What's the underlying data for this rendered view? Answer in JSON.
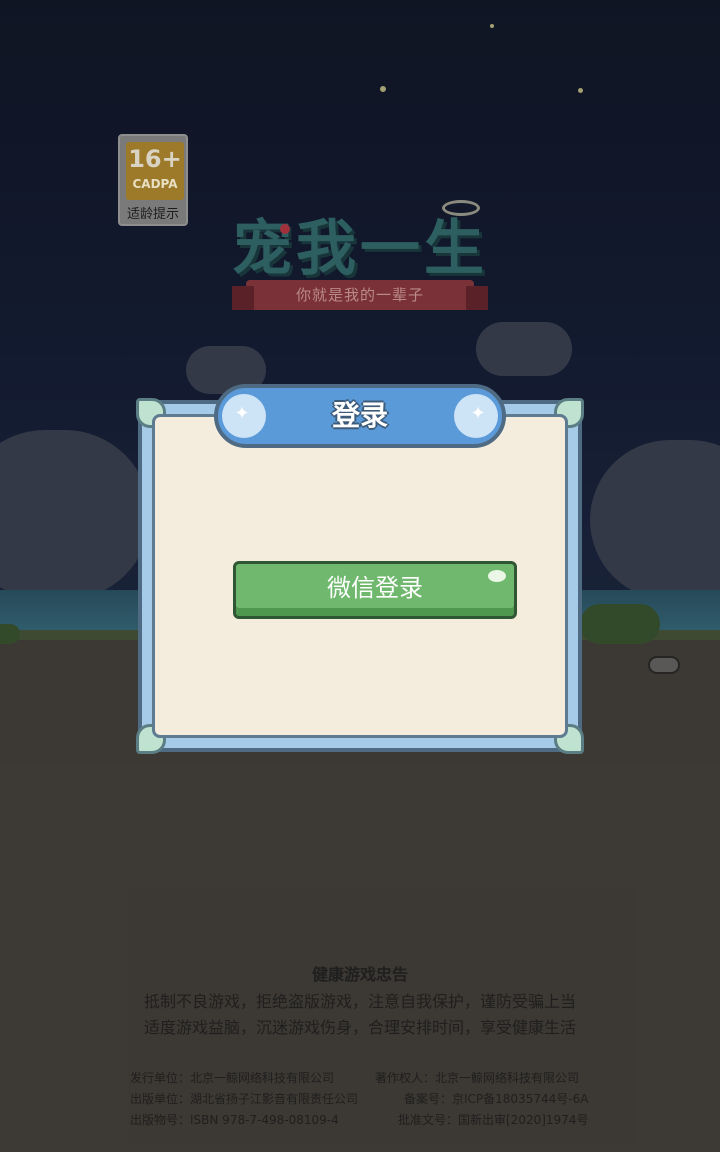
{
  "age_badge": {
    "rating": "16+",
    "org": "CADPA",
    "label": "适龄提示"
  },
  "logo": {
    "title": "宠我一生",
    "subtitle": "你就是我的一辈子"
  },
  "login_dialog": {
    "title": "登录",
    "wechat_button_label": "微信登录"
  },
  "health_notice": {
    "title": "健康游戏忠告",
    "lines": [
      "抵制不良游戏，拒绝盗版游戏，注意自我保护，谨防受骗上当",
      "适度游戏益脑，沉迷游戏伤身，合理安排时间，享受健康生活"
    ]
  },
  "publication_info": {
    "publisher": "发行单位：北京一鲸网络科技有限公司",
    "copyright_holder": "著作权人：北京一鲸网络科技有限公司",
    "publishing_unit": "出版单位：湖北省扬子江影音有限责任公司",
    "record_number": "备案号：京ICP备18035744号-6A",
    "publication_number": "出版物号：ISBN 978-7-498-08109-4",
    "approval_number": "批准文号：国新出审[2020]1974号"
  },
  "colors": {
    "dialog_frame": "#a6cbe8",
    "dialog_panel": "#f4ecdd",
    "title_plate": "#5b9ad8",
    "wechat_button": "#6fb86e"
  }
}
